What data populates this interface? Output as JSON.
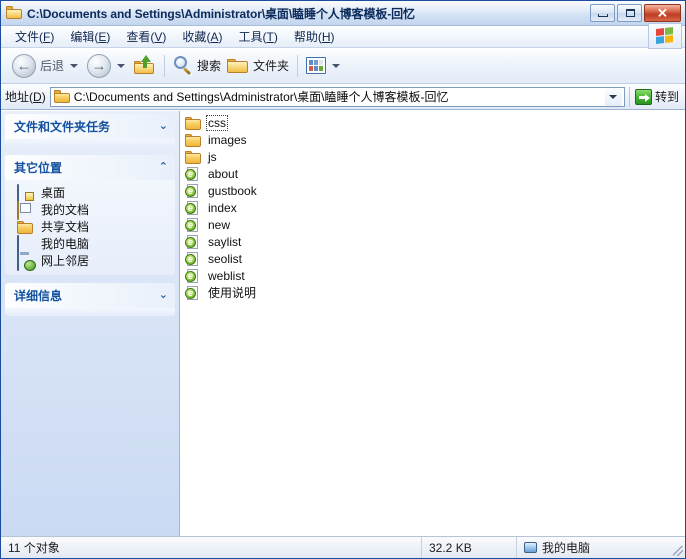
{
  "window": {
    "title": "C:\\Documents and Settings\\Administrator\\桌面\\瞌睡个人博客模板-回忆",
    "title_icon": "folder-icon",
    "controls": {
      "minimize": "minimize-button",
      "maximize": "maximize-button",
      "close_label": "✕"
    }
  },
  "menubar": {
    "items": [
      {
        "label": "文件",
        "accel": "F"
      },
      {
        "label": "编辑",
        "accel": "E"
      },
      {
        "label": "查看",
        "accel": "V"
      },
      {
        "label": "收藏",
        "accel": "A"
      },
      {
        "label": "工具",
        "accel": "T"
      },
      {
        "label": "帮助",
        "accel": "H"
      }
    ],
    "logo": "windows-flag-icon"
  },
  "toolbar": {
    "back_label": "后退",
    "forward_label": "",
    "up_label": "",
    "search_label": "搜索",
    "folders_label": "文件夹",
    "views_label": ""
  },
  "address": {
    "label": "地址",
    "accel": "D",
    "path": "C:\\Documents and Settings\\Administrator\\桌面\\瞌睡个人博客模板-回忆",
    "go_label": "转到"
  },
  "sidebar": {
    "panels": [
      {
        "title": "文件和文件夹任务",
        "expanded": false,
        "chevron": "⌄",
        "items": []
      },
      {
        "title": "其它位置",
        "expanded": true,
        "chevron": "⌃",
        "items": [
          {
            "label": "桌面",
            "icon": "desktop-icon"
          },
          {
            "label": "我的文档",
            "icon": "my-documents-icon"
          },
          {
            "label": "共享文档",
            "icon": "shared-documents-icon"
          },
          {
            "label": "我的电脑",
            "icon": "my-computer-icon"
          },
          {
            "label": "网上邻居",
            "icon": "network-places-icon"
          }
        ]
      },
      {
        "title": "详细信息",
        "expanded": false,
        "chevron": "⌄",
        "items": []
      }
    ]
  },
  "files": [
    {
      "name": "css",
      "type": "folder",
      "icon": "folder-icon",
      "focused": true
    },
    {
      "name": "images",
      "type": "folder",
      "icon": "folder-icon",
      "focused": false
    },
    {
      "name": "js",
      "type": "folder",
      "icon": "folder-icon",
      "focused": false
    },
    {
      "name": "about",
      "type": "html",
      "icon": "ie-document-icon",
      "focused": false
    },
    {
      "name": "gustbook",
      "type": "html",
      "icon": "ie-document-icon",
      "focused": false
    },
    {
      "name": "index",
      "type": "html",
      "icon": "ie-document-icon",
      "focused": false
    },
    {
      "name": "new",
      "type": "html",
      "icon": "ie-document-icon",
      "focused": false
    },
    {
      "name": "saylist",
      "type": "html",
      "icon": "ie-document-icon",
      "focused": false
    },
    {
      "name": "seolist",
      "type": "html",
      "icon": "ie-document-icon",
      "focused": false
    },
    {
      "name": "weblist",
      "type": "html",
      "icon": "ie-document-icon",
      "focused": false
    },
    {
      "name": "使用说明",
      "type": "html",
      "icon": "ie-document-icon",
      "focused": false
    }
  ],
  "statusbar": {
    "object_count": "11 个对象",
    "total_size": "32.2 KB",
    "location": "我的电脑",
    "location_icon": "my-computer-icon"
  },
  "colors": {
    "title_text": "#0b2a5b",
    "panel_title": "#12519f",
    "close_button": "#bd3d23",
    "go_button": "#46b733",
    "folder_yellow": "#f8cf63",
    "ie_green": "#9fd44e"
  }
}
